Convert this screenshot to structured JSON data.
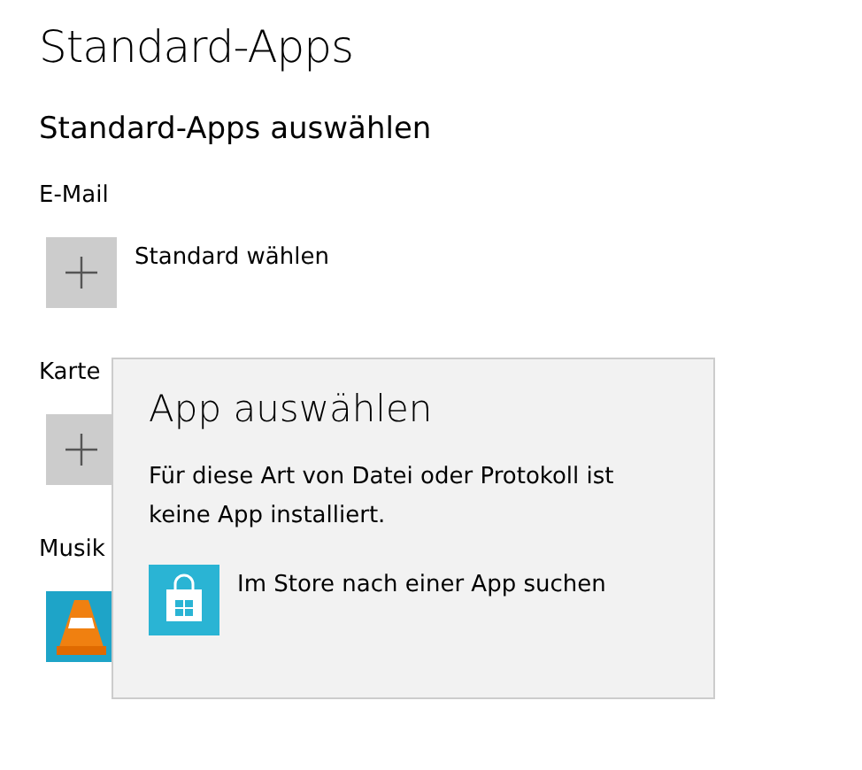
{
  "page_title": "Standard-Apps",
  "section_title": "Standard-Apps auswählen",
  "categories": [
    {
      "label": "E-Mail",
      "kind": "add",
      "action": "Standard wählen"
    },
    {
      "label": "Karte",
      "kind": "add"
    },
    {
      "label": "Musik",
      "kind": "app"
    }
  ],
  "popup": {
    "title": "App auswählen",
    "message": "Für diese Art von Datei oder Protokoll ist keine App installiert.",
    "store_link": "Im Store nach einer App suchen"
  }
}
